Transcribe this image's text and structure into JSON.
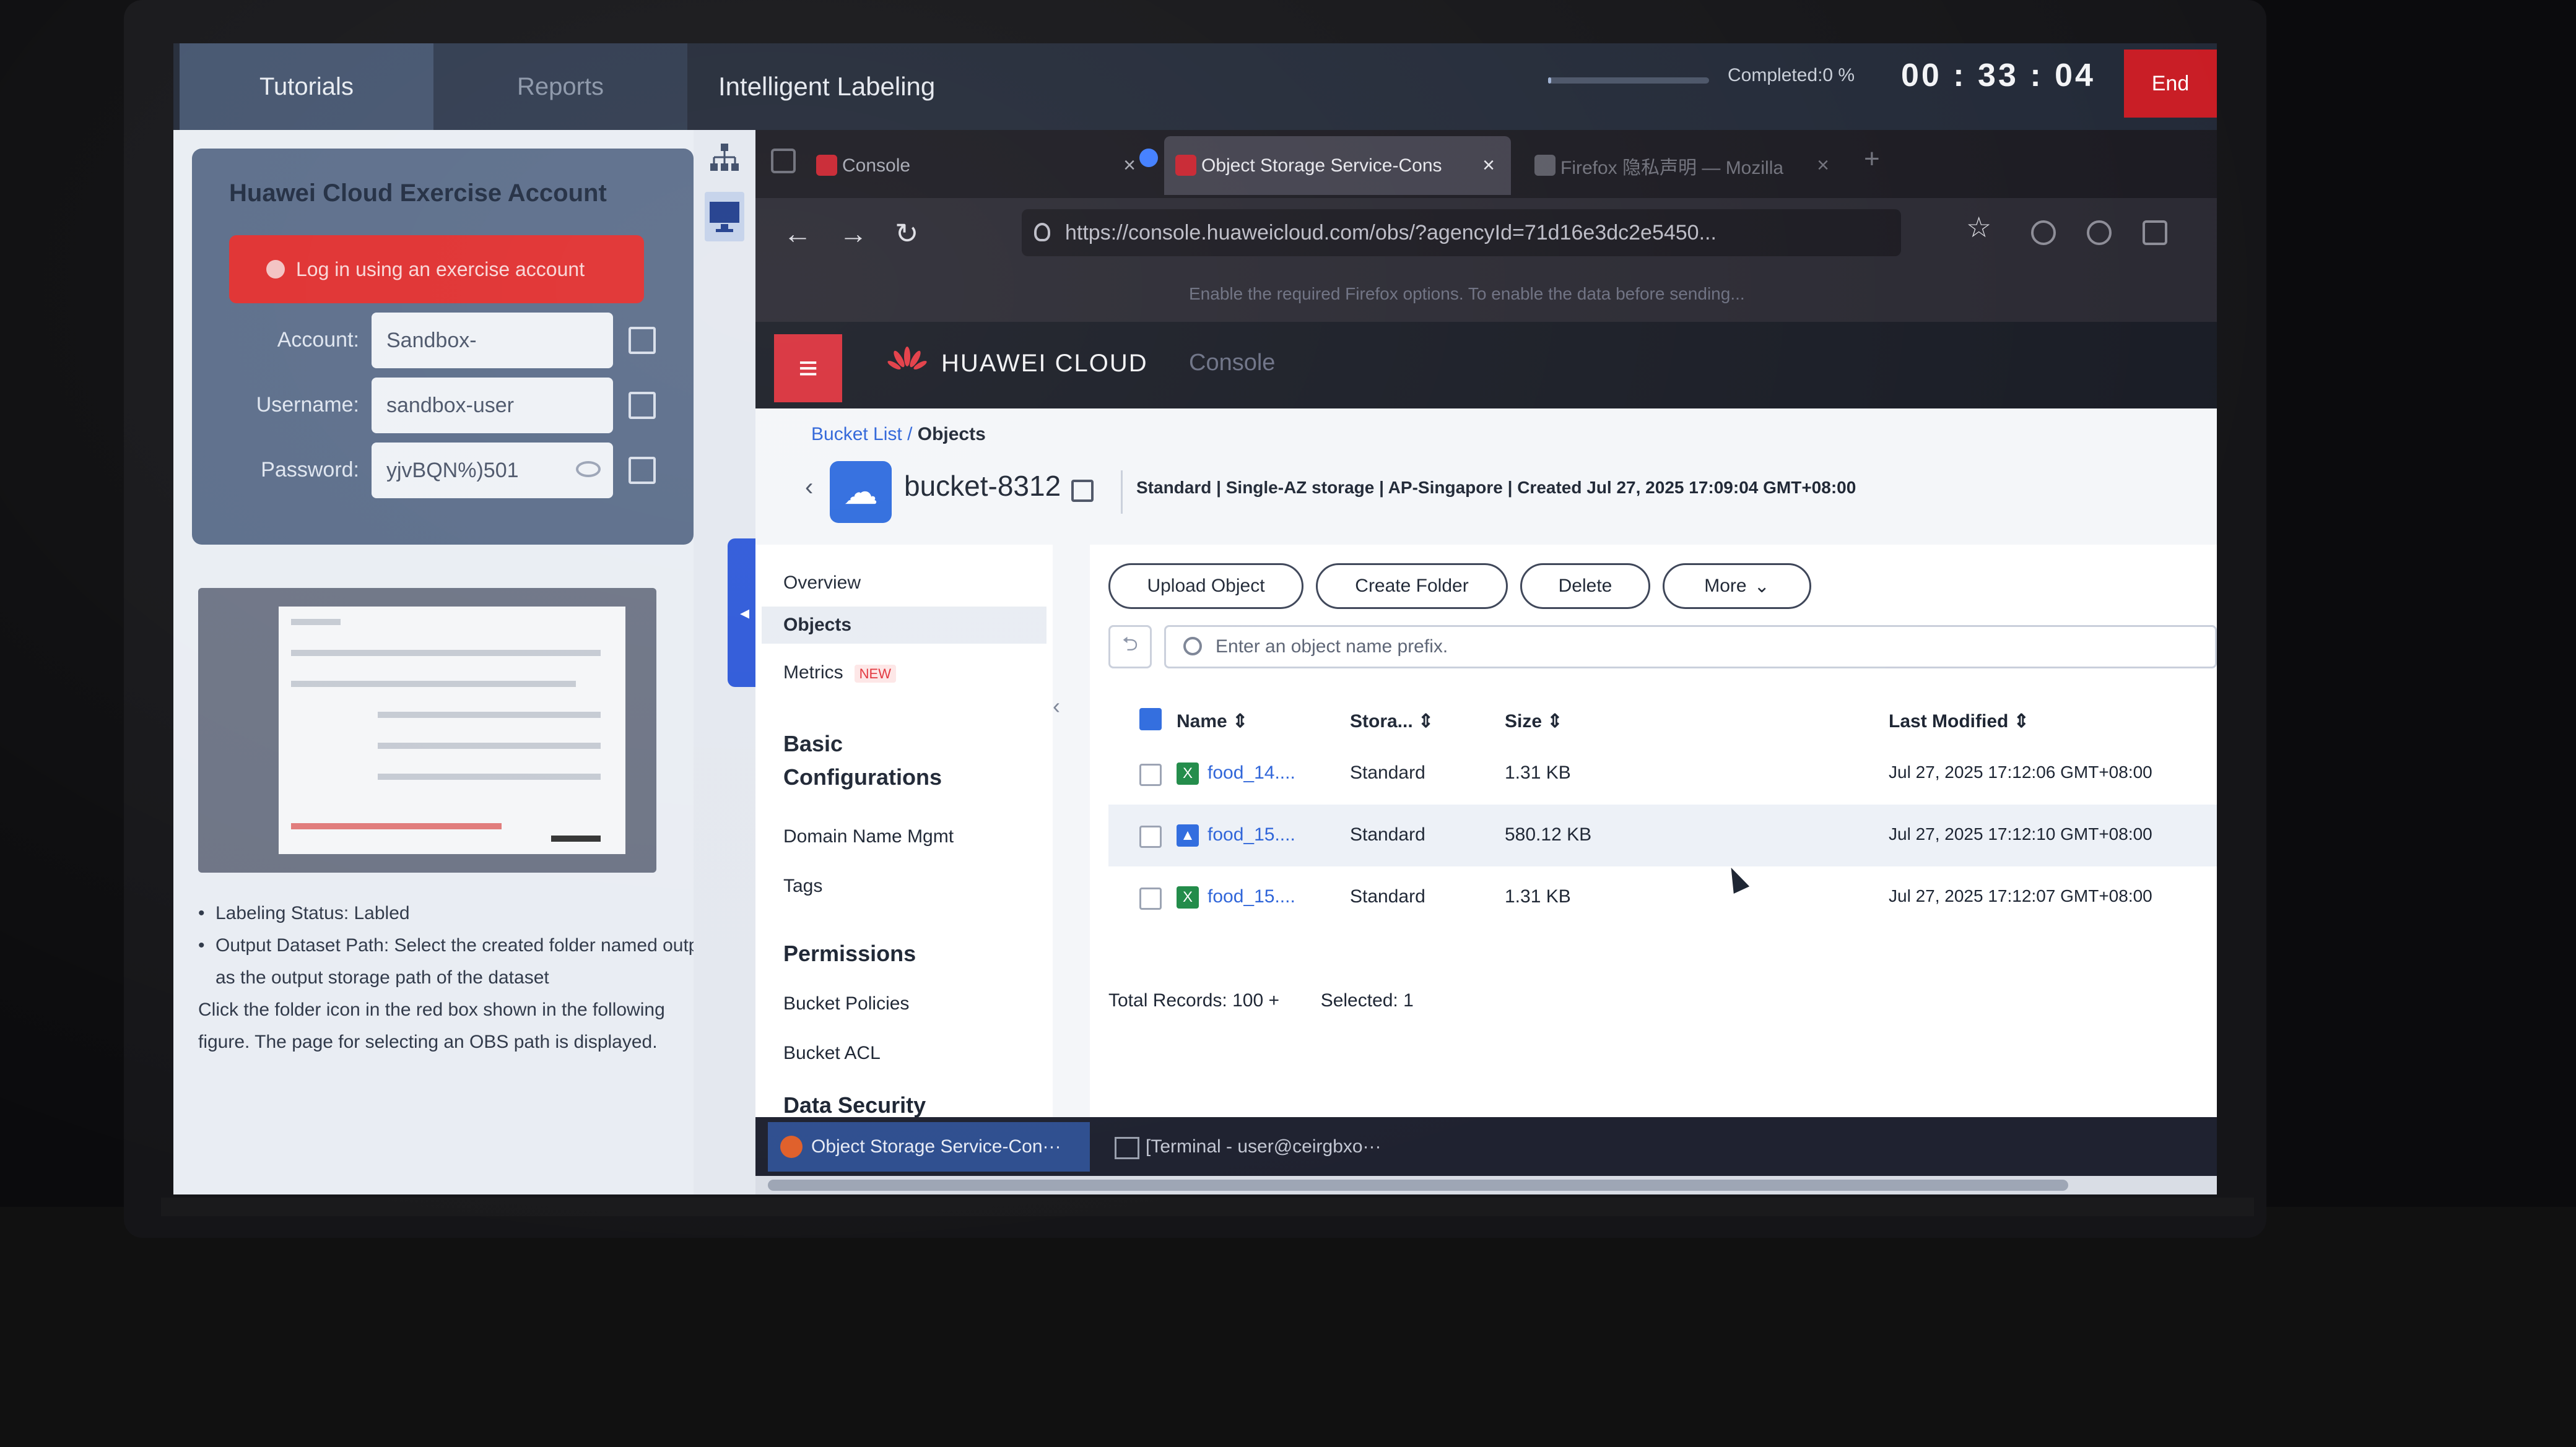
{
  "app": {
    "tabs": [
      "Tutorials",
      "Reports"
    ],
    "title": "Intelligent Labeling",
    "completed_label": "Completed:0 %",
    "progress_fraction": 0.0,
    "timer": "00 : 33 : 04",
    "end_label": "End"
  },
  "account": {
    "title": "Huawei Cloud Exercise Account",
    "login_button": "Log in using an exercise account",
    "account_label": "Account:",
    "account_value": "Sandbox-",
    "username_label": "Username:",
    "username_value": "sandbox-user",
    "password_label": "Password:",
    "password_value": "yjvBQN%)501"
  },
  "guide": {
    "labeling_status": "Labeling Status:   Labled",
    "output_path": "Output Dataset Path: Select the created folder named output as the output storage path of the dataset",
    "instruction": "Click the folder icon in the red box shown in the following figure. The page for selecting an OBS path is displayed."
  },
  "browser": {
    "tabs": [
      {
        "label": "Console"
      },
      {
        "label": "Object Storage Service-Cons"
      },
      {
        "label": "Firefox 隐私声明 — Mozilla"
      }
    ],
    "url": "https://console.huaweicloud.com/obs/?agencyId=71d16e3dc2e5450...",
    "notice": "Enable the required Firefox options. To enable the data before sending..."
  },
  "hw_header": {
    "brand": "HUAWEI CLOUD",
    "console_label": "Console"
  },
  "obs": {
    "breadcrumb_link": "Bucket List",
    "breadcrumb_sep": " / ",
    "breadcrumb_current": "Objects",
    "bucket_name": "bucket-8312",
    "bucket_meta": "Standard | Single-AZ storage | AP-Singapore | Created  Jul 27, 2025 17:09:04 GMT+08:00",
    "nav": {
      "overview": "Overview",
      "objects": "Objects",
      "metrics": "Metrics",
      "metrics_badge": "NEW",
      "basic_config": "Basic Configurations",
      "domain": "Domain Name Mgmt",
      "tags": "Tags",
      "permissions": "Permissions",
      "bucket_policies": "Bucket Policies",
      "bucket_acl": "Bucket ACL",
      "data_security": "Data Security"
    },
    "toolbar": {
      "upload": "Upload Object",
      "create_folder": "Create Folder",
      "delete": "Delete",
      "more": "More"
    },
    "search_placeholder": "Enter an object name prefix.",
    "columns": {
      "name": "Name",
      "storage": "Stora...",
      "size": "Size",
      "last_modified": "Last Modified"
    },
    "rows": [
      {
        "name": "food_14....",
        "storage": "Standard",
        "size": "1.31 KB",
        "modified": "Jul 27, 2025 17:12:06 GMT+08:00",
        "type": "xls"
      },
      {
        "name": "food_15....",
        "storage": "Standard",
        "size": "580.12 KB",
        "modified": "Jul 27, 2025 17:12:10 GMT+08:00",
        "type": "img"
      },
      {
        "name": "food_15....",
        "storage": "Standard",
        "size": "1.31 KB",
        "modified": "Jul 27, 2025 17:12:07 GMT+08:00",
        "type": "xls"
      }
    ],
    "total_records": "Total Records: 100 +",
    "selected": "Selected: 1"
  },
  "taskbar": {
    "obs": "Object Storage Service-Con···",
    "terminal": "[Terminal - user@ceirgbxo···"
  },
  "colors": {
    "accent_blue": "#2e6bde",
    "huawei_red": "#d8303b",
    "end_red": "#c91d25"
  }
}
